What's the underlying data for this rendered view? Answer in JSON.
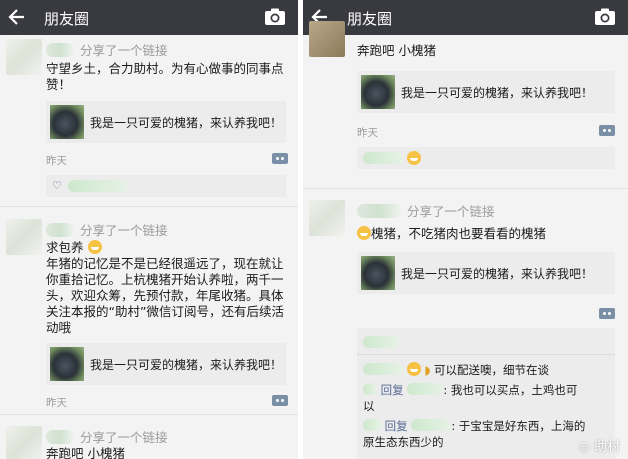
{
  "titlebar": {
    "title": "朋友圈"
  },
  "left": {
    "post1": {
      "shared": "分享了一个链接",
      "text": [
        "守望乡土，合力助村。为有心做事的同事点",
        "赞！"
      ],
      "link": "我是一只可爱的槐猪，来认养我吧！",
      "time": "昨天"
    },
    "post2": {
      "shared": "分享了一个链接",
      "text": [
        "求包养",
        "年猪的记忆是不是已经很遥远了，现在就让",
        "你重拾记忆。上杭槐猪开始认养啦，两千一",
        "头，欢迎众筹，先预付款，年尾收猪。具体",
        "关注本报的“助村”微信订阅号，还有后续活",
        "动哦"
      ],
      "link": "我是一只可爱的槐猪，来认养我吧！",
      "time": "昨天"
    },
    "post3": {
      "shared": "分享了一个链接",
      "text": "奔跑吧 小槐猪"
    }
  },
  "right": {
    "post1": {
      "text": "奔跑吧 小槐猪",
      "link": "我是一只可爱的槐猪，来认养我吧！",
      "time": "昨天"
    },
    "post2": {
      "shared": "分享了一个链接",
      "text": "槐猪，不吃猪肉也要看看的槐猪",
      "link": "我是一只可爱的槐猪，来认养我吧！",
      "comments": [
        {
          "name": "",
          "text": "可以配送噢，细节在谈"
        },
        {
          "name": "回复",
          "text": "我也可以买点，土鸡也可"
        },
        {
          "name": "",
          "text": "以"
        },
        {
          "name": "回复",
          "text": "于宝宝是好东西，上海的"
        },
        {
          "name": "",
          "text": "原生态东西少的"
        }
      ]
    }
  },
  "watermark": "助村",
  "icons": [
    "back-arrow-icon",
    "camera-icon",
    "heart-icon",
    "comment-icon",
    "smile-emoji-icon",
    "banana-emoji-icon"
  ]
}
